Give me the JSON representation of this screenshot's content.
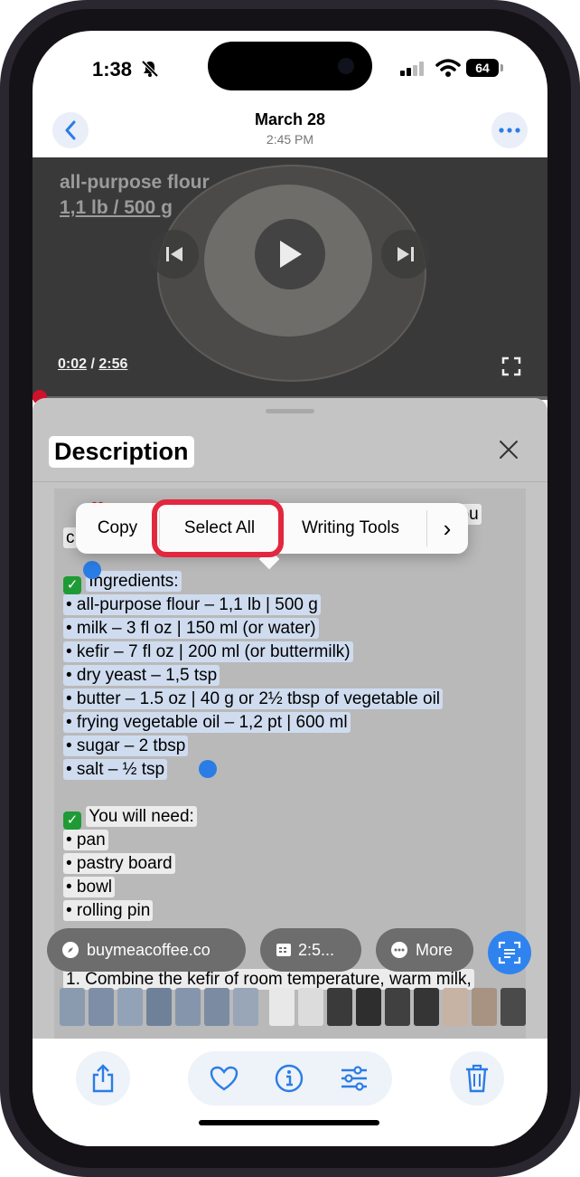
{
  "status_bar": {
    "time": "1:38",
    "battery": "64"
  },
  "header": {
    "title": "March 28",
    "subtitle": "2:45 PM"
  },
  "video": {
    "overlay_line1": "all-purpose flour",
    "overlay_line2": "1,1 lb / 500 g",
    "current_time": "0:02",
    "separator": " / ",
    "duration": "2:56"
  },
  "description": {
    "title": "Description",
    "top_line_right": "you",
    "top_line_left": "c",
    "ingredients_header": "Ingredients:",
    "ingredients": [
      "• all-purpose flour – 1,1 lb | 500 g",
      "• milk – 3 fl oz | 150 ml (or water)",
      "• kefir – 7 fl oz | 200 ml (or buttermilk)",
      "• dry yeast – 1,5 tsp",
      "• butter – 1.5 oz | 40 g or 2½ tbsp of vegetable oil",
      "• frying vegetable oil – 1,2 pt | 600 ml",
      "• sugar – 2 tbsp",
      "• salt – ½ tsp"
    ],
    "need_header": "You will need:",
    "need_items": [
      "• pan",
      "• pastry board",
      "• bowl",
      "• rolling pin"
    ],
    "step_line1": "1. Combine the kefir of room temperature, warm milk,"
  },
  "context_menu": {
    "copy": "Copy",
    "select_all": "Select All",
    "writing_tools": "Writing Tools",
    "next": "›"
  },
  "pills": {
    "link": "buymeacoffee.co",
    "time": "2:5...",
    "more": "More"
  },
  "colors": {
    "accent": "#2f83ee",
    "highlight_red": "#e3273f",
    "selection": "#cfdcef"
  }
}
